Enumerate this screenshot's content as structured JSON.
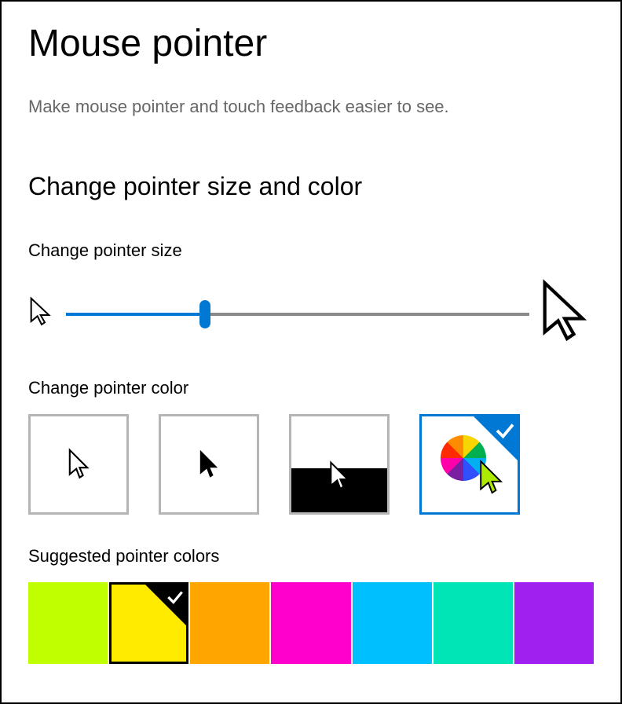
{
  "title": "Mouse pointer",
  "subtitle": "Make mouse pointer and touch feedback easier to see.",
  "section_heading": "Change pointer size and color",
  "size_label": "Change pointer size",
  "color_label": "Change pointer color",
  "suggested_label": "Suggested pointer colors",
  "slider": {
    "percent": 30
  },
  "color_styles": [
    {
      "id": "white",
      "selected": false
    },
    {
      "id": "black",
      "selected": false
    },
    {
      "id": "inverted",
      "selected": false
    },
    {
      "id": "custom",
      "selected": true
    }
  ],
  "suggested_colors": [
    {
      "hex": "#BFFF00",
      "selected": false
    },
    {
      "hex": "#FFEB00",
      "selected": true
    },
    {
      "hex": "#FFA500",
      "selected": false
    },
    {
      "hex": "#FF00CC",
      "selected": false
    },
    {
      "hex": "#00BFFF",
      "selected": false
    },
    {
      "hex": "#00E5B5",
      "selected": false
    },
    {
      "hex": "#A020F0",
      "selected": false
    }
  ]
}
